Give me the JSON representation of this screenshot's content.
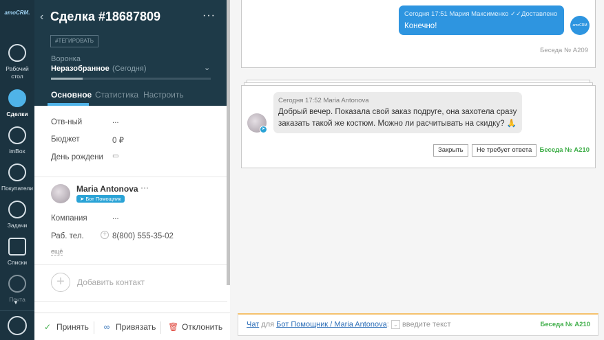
{
  "nav": {
    "logo": "amoCRM.",
    "items": [
      {
        "label": "Рабочий стол"
      },
      {
        "label": "Сделки"
      },
      {
        "label": "imBox"
      },
      {
        "label": "Покупатели"
      },
      {
        "label": "Задачи"
      },
      {
        "label": "Списки"
      },
      {
        "label": "Почта"
      }
    ]
  },
  "lead": {
    "title": "Сделка #18687809",
    "menu": "···",
    "tag_button": "#ТЕГИРОВАТЬ",
    "funnel_label": "Воронка",
    "funnel_value": "Неразобранное",
    "funnel_date": "(Сегодня)",
    "progress_fraction": 0.2,
    "tabs": [
      "Основное",
      "Статистика",
      "Настроить"
    ],
    "fields": [
      {
        "label": "Отв-ный",
        "value": "..."
      },
      {
        "label": "Бюджет",
        "value": "0 ₽"
      },
      {
        "label": "День рождени",
        "value": ""
      }
    ],
    "contact": {
      "name": "Maria Antonova",
      "menu": "···",
      "badge": "Бот Помощник",
      "company_label": "Компания",
      "company_value": "...",
      "phone_label": "Раб. тел.",
      "phone_value": "8(800) 555-35-02",
      "more": "ещё"
    },
    "add_contact": "Добавить контакт",
    "actions": {
      "accept": "Принять",
      "link": "Привязать",
      "decline": "Отклонить"
    }
  },
  "feed": {
    "msg1": {
      "meta": "Сегодня 17:51 Мария Максименко",
      "status": "Доставлено",
      "text": "Конечно!",
      "avatar_text": "amoCRM",
      "conversation": "Беседа № А209"
    },
    "msg2": {
      "meta": "Сегодня 17:52 Maria Antonova",
      "text": "Добрый вечер. Показала свой заказ подруге, она захотела сразу заказать такой же костюм. Можно ли расчитывать на скидку? 🙏",
      "close_button": "Закрыть",
      "no_reply_button": "Не требует ответа",
      "conversation": "Беседа № А210"
    },
    "composer": {
      "chat": "Чат",
      "for": "для",
      "recipient": "Бот Помощник / Maria Antonova",
      "placeholder": "введите текст",
      "conversation": "Беседа № А210"
    },
    "colors": {
      "accent": "#4fb3e8",
      "bubble_out": "#2e95e0",
      "bubble_in": "#ebebeb",
      "convo_active": "#3fae49"
    }
  }
}
